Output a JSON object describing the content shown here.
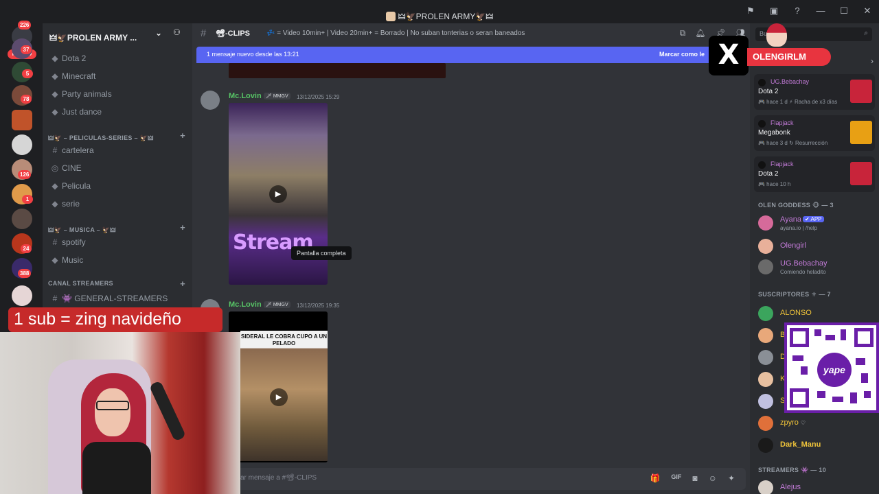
{
  "window": {
    "title": "🜲🦅PROLEN ARMY🦅🜲",
    "icons": [
      "⚑",
      "▣",
      "?",
      "—",
      "☐",
      "✕"
    ]
  },
  "rail": {
    "nuevo_label": "NUEVO",
    "badges": [
      "226",
      "37",
      "5",
      "78",
      "126",
      "1",
      "24",
      "388"
    ]
  },
  "sidebar": {
    "guild_name": "🜲🦅PROLEN ARMY ...",
    "channels_top": [
      {
        "icon": "◆",
        "label": "Dota 2"
      },
      {
        "icon": "◆",
        "label": "Minecraft"
      },
      {
        "icon": "◆",
        "label": "Party animals"
      },
      {
        "icon": "◆",
        "label": "Just dance"
      }
    ],
    "cat_peliculas": "🜲🦅 – PELICULAS-SERIES – 🦅🜲",
    "channels_peliculas": [
      {
        "icon": "#",
        "label": "cartelera"
      },
      {
        "icon": "◎",
        "label": "CINE"
      },
      {
        "icon": "◆",
        "label": "Pelicula"
      },
      {
        "icon": "◆",
        "label": "serie"
      }
    ],
    "cat_musica": "🜲🦅 – MUSICA – 🦅🜲",
    "channels_musica": [
      {
        "icon": "#",
        "label": "spotify"
      },
      {
        "icon": "◆",
        "label": "Music"
      }
    ],
    "cat_streamers": "CANAL STREAMERS",
    "channel_streamers": {
      "icon": "#",
      "label": "👾 GENERAL-STREAMERS"
    }
  },
  "chat": {
    "channel_name": "📽-CLIPS",
    "topic": "💤 = Video 10min+ | Video 20min+ = Borrado | No suban tonterias o seran baneados",
    "new_messages_text": "1 mensaje nuevo desde las 13:21",
    "mark_read": "Marcar como le",
    "messages": [
      {
        "author": "Mc.Lovin",
        "tag": "🗡 MMGV",
        "time": "13/12/2025 15:29",
        "video_text": "Stream"
      },
      {
        "author": "Mc.Lovin",
        "tag": "🗡 MMGV",
        "time": "13/12/2025 19:35",
        "video_caption": "SIDERAL LE COBRA CUPO A UN PELADO"
      }
    ],
    "tooltip": "Pantalla completa",
    "input_placeholder": "ar mensaje a #📽-CLIPS",
    "input_icons": [
      "🎁",
      "GIF",
      "◙",
      "☺",
      "✦"
    ]
  },
  "members": {
    "search_placeholder": "Bu",
    "activities": [
      {
        "user": "UG.Bebachay",
        "game": "Dota 2",
        "meta": "🎮 hace 1 d  ⚡ Racha de x3 días",
        "art_color": "#c8243a"
      },
      {
        "user": "Flapjack",
        "game": "Megabonk",
        "meta": "🎮 hace 3 d  ↻ Resurrección",
        "art_color": "#e8a014"
      },
      {
        "user": "Flapjack",
        "game": "Dota 2",
        "meta": "🎮 hace 10 h",
        "art_color": "#c8243a"
      }
    ],
    "groups": {
      "olen": "OLEN GODDESS 🐵 — 3",
      "suscriptores": "SUSCRIPTORES ⚜ — 7",
      "streamers": "STREAMERS 👾 — 10"
    },
    "olen_members": [
      {
        "name": "Ayana",
        "badge": "✔ APP",
        "status": "ayana.io | /help"
      },
      {
        "name": "Olengirl",
        "badge": "",
        "status": ""
      },
      {
        "name": "UG.Bebachay",
        "badge": "",
        "status": "Comiendo heladito"
      }
    ],
    "sub_members": [
      {
        "name": "ALONSO"
      },
      {
        "name": "B"
      },
      {
        "name": "D"
      },
      {
        "name": "K"
      },
      {
        "name": "S"
      },
      {
        "name": "zpyro"
      },
      {
        "name": "Dark_Manu"
      }
    ],
    "streamer_members": [
      {
        "name": "Alejus"
      }
    ]
  },
  "overlays": {
    "x_logo": "X",
    "x_handle": "OLENGIRLM",
    "sub_banner": "1 sub = zing navideño",
    "qr_logo": "yape"
  },
  "colors": {
    "accent": "#5865f2",
    "author_green": "#57c566",
    "member_pink": "#c37bd8",
    "sub_gold": "#f0c43a",
    "badge_red": "#f23f43"
  }
}
